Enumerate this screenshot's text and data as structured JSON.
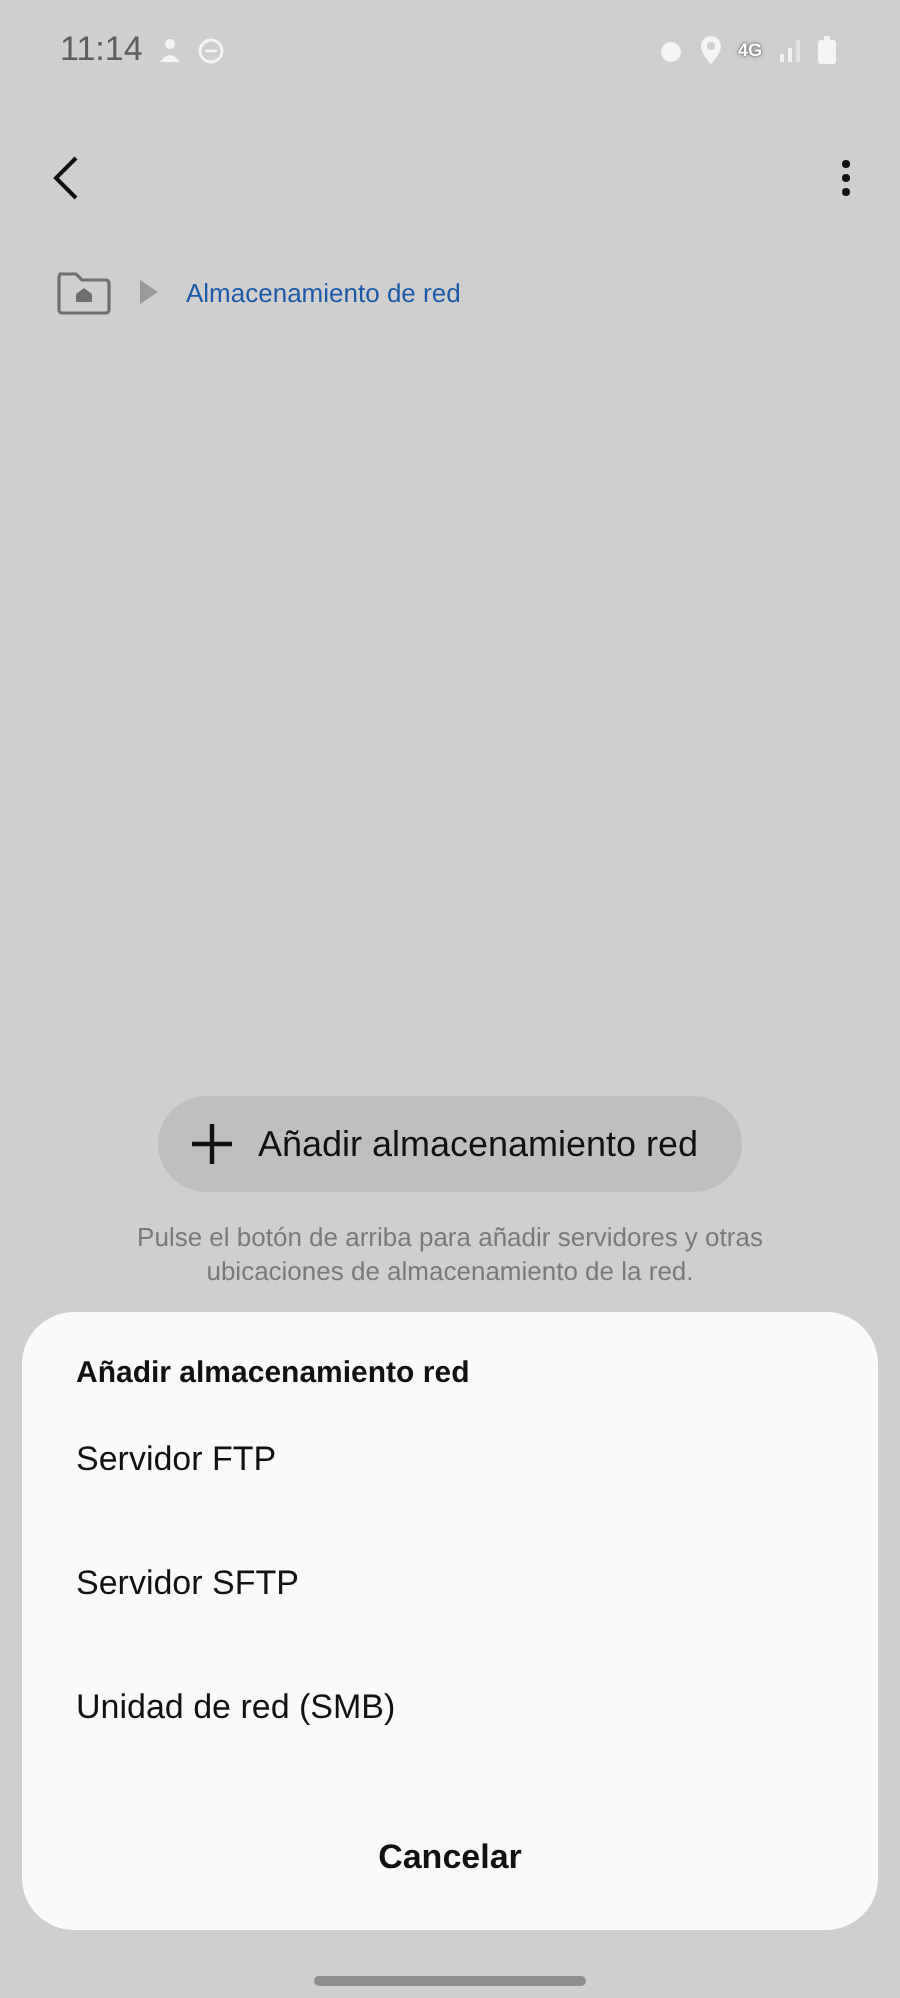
{
  "status_bar": {
    "time": "11:14",
    "network_type": "4G"
  },
  "breadcrumb": {
    "current": "Almacenamiento de red"
  },
  "add_button": {
    "label": "Añadir almacenamiento red"
  },
  "hint": "Pulse el botón de arriba para añadir servidores y otras ubicaciones de almacenamiento de la red.",
  "sheet": {
    "title": "Añadir almacenamiento red",
    "options": [
      {
        "label": "Servidor FTP"
      },
      {
        "label": "Servidor SFTP"
      },
      {
        "label": "Unidad de red (SMB)"
      }
    ],
    "cancel": "Cancelar"
  }
}
